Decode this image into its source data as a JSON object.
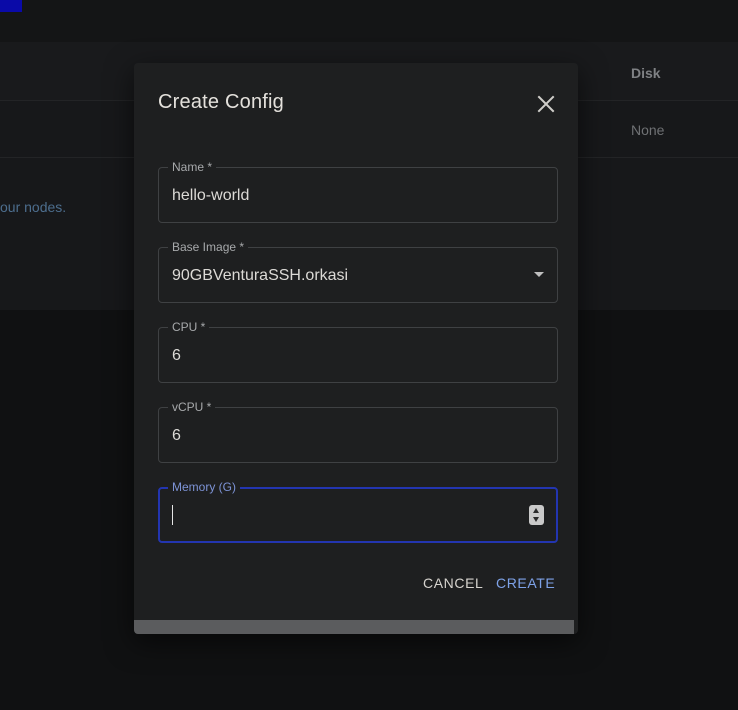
{
  "background": {
    "table": {
      "disk_header": "Disk",
      "disk_value": "None"
    },
    "footnote": "our nodes."
  },
  "dialog": {
    "title": "Create Config",
    "fields": {
      "name": {
        "label": "Name *",
        "value": "hello-world"
      },
      "base_image": {
        "label": "Base Image *",
        "value": "90GBVenturaSSH.orkasi"
      },
      "cpu": {
        "label": "CPU *",
        "value": "6"
      },
      "vcpu": {
        "label": "vCPU *",
        "value": "6"
      },
      "memory": {
        "label": "Memory (G)",
        "value": ""
      }
    },
    "actions": {
      "cancel": "CANCEL",
      "create": "CREATE"
    }
  },
  "colors": {
    "accent": "#7ea2e8",
    "focus_border": "#2335b0",
    "dialog_bg": "#1e1f20"
  },
  "icons": {
    "close": "close-icon",
    "dropdown": "chevron-down-icon",
    "spinner": "number-spinner-icon"
  }
}
